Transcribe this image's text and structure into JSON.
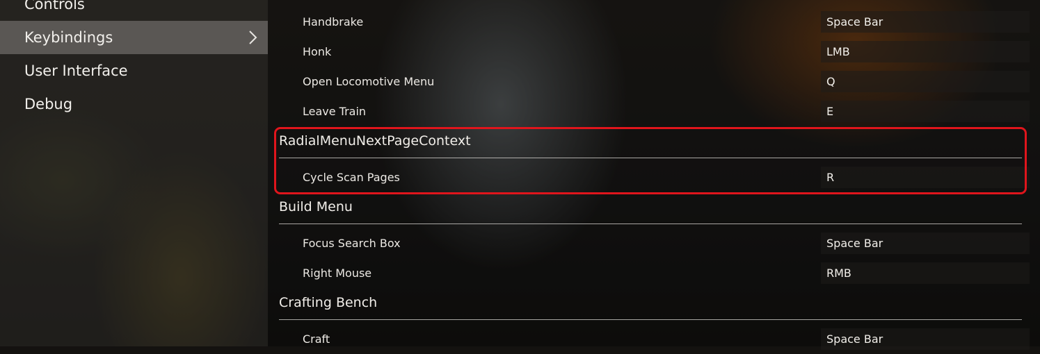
{
  "sidebar": {
    "items": [
      {
        "label": "Controls"
      },
      {
        "label": "Keybindings",
        "active": true
      },
      {
        "label": "User Interface"
      },
      {
        "label": "Debug"
      }
    ],
    "active_chevron": "›"
  },
  "keybindings": {
    "locomotive": [
      {
        "action": "Handbrake",
        "key": "Space Bar"
      },
      {
        "action": "Honk",
        "key": "LMB"
      },
      {
        "action": "Open Locomotive Menu",
        "key": "Q"
      },
      {
        "action": "Leave Train",
        "key": "E"
      }
    ],
    "radial": {
      "title": "RadialMenuNextPageContext",
      "items": [
        {
          "action": "Cycle Scan Pages",
          "key": "R"
        }
      ]
    },
    "build": {
      "title": "Build Menu",
      "items": [
        {
          "action": "Focus Search Box",
          "key": "Space Bar"
        },
        {
          "action": "Right Mouse",
          "key": "RMB"
        }
      ]
    },
    "crafting": {
      "title": "Crafting Bench",
      "items": [
        {
          "action": "Craft",
          "key": "Space Bar"
        }
      ]
    }
  },
  "highlight_color": "#e0151c"
}
